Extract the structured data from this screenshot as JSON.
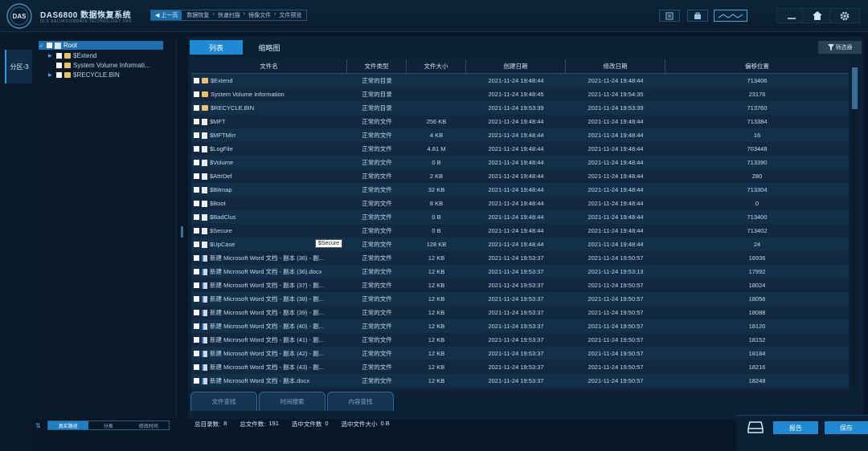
{
  "app": {
    "brand": "DAS6800 数据恢复系统",
    "brand_sub": "DLS SALVATIONDATA TECHNOLOGY DAS"
  },
  "nav": {
    "back_label": "上一页",
    "breadcrumb": [
      "数据恢复",
      "快速扫描",
      "镜像文件",
      "文件预览"
    ]
  },
  "sidebar": {
    "partition_tab": "分区-3"
  },
  "tree": {
    "items": [
      "Root",
      "$Extend",
      "System Volume Informati...",
      "$RECYCLE.BIN"
    ]
  },
  "sort_tabs": [
    "真实路径",
    "分类",
    "修改时间"
  ],
  "tabs": [
    "列表",
    "缩略图"
  ],
  "filter_label": "筛选器",
  "columns": [
    "文件名",
    "文件类型",
    "文件大小",
    "创建日期",
    "修改日期",
    "偏移位置"
  ],
  "rows": [
    [
      "$Extend",
      "正常的目录",
      "",
      "2021-11-24 19:48:44",
      "2021-11-24 19:48:44",
      "713406"
    ],
    [
      "System Volume Information",
      "正常的目录",
      "",
      "2021-11-24 19:48:45",
      "2021-11-24 19:54:35",
      "23176"
    ],
    [
      "$RECYCLE.BIN",
      "正常的目录",
      "",
      "2021-11-24 19:53:39",
      "2021-11-24 19:53:39",
      "713760"
    ],
    [
      "$MFT",
      "正常的文件",
      "256 KB",
      "2021-11-24 19:48:44",
      "2021-11-24 19:48:44",
      "713384"
    ],
    [
      "$MFTMirr",
      "正常的文件",
      "4 KB",
      "2021-11-24 19:48:44",
      "2021-11-24 19:48:44",
      "16"
    ],
    [
      "$LogFile",
      "正常的文件",
      "4.81 M",
      "2021-11-24 19:48:44",
      "2021-11-24 19:48:44",
      "703448"
    ],
    [
      "$Volume",
      "正常的文件",
      "0 B",
      "2021-11-24 19:48:44",
      "2021-11-24 19:48:44",
      "713390"
    ],
    [
      "$AttrDef",
      "正常的文件",
      "2 KB",
      "2021-11-24 19:48:44",
      "2021-11-24 19:48:44",
      "280"
    ],
    [
      "$Bitmap",
      "正常的文件",
      "32 KB",
      "2021-11-24 19:48:44",
      "2021-11-24 19:48:44",
      "713304"
    ],
    [
      "$Boot",
      "正常的文件",
      "8 KB",
      "2021-11-24 19:48:44",
      "2021-11-24 19:48:44",
      "0"
    ],
    [
      "$BadClus",
      "正常的文件",
      "0 B",
      "2021-11-24 19:48:44",
      "2021-11-24 19:48:44",
      "713400"
    ],
    [
      "$Secure",
      "正常的文件",
      "0 B",
      "2021-11-24 19:48:44",
      "2021-11-24 19:48:44",
      "713402"
    ],
    [
      "$UpCase",
      "正常的文件",
      "128 KB",
      "2021-11-24 19:48:44",
      "2021-11-24 19:48:44",
      "24"
    ],
    [
      "新建 Microsoft Word 文档 - 副本 (36) - 副...",
      "正常的文件",
      "12 KB",
      "2021-11-24 19:53:37",
      "2021-11-24 19:50:57",
      "16936"
    ],
    [
      "新建 Microsoft Word 文档 - 副本 (36).docx",
      "正常的文件",
      "12 KB",
      "2021-11-24 19:53:37",
      "2021-11-24 19:53:13",
      "17992"
    ],
    [
      "新建 Microsoft Word 文档 - 副本 (37) - 副...",
      "正常的文件",
      "12 KB",
      "2021-11-24 19:53:37",
      "2021-11-24 19:50:57",
      "18024"
    ],
    [
      "新建 Microsoft Word 文档 - 副本 (38) - 副...",
      "正常的文件",
      "12 KB",
      "2021-11-24 19:53:37",
      "2021-11-24 19:50:57",
      "18056"
    ],
    [
      "新建 Microsoft Word 文档 - 副本 (39) - 副...",
      "正常的文件",
      "12 KB",
      "2021-11-24 19:53:37",
      "2021-11-24 19:50:57",
      "18088"
    ],
    [
      "新建 Microsoft Word 文档 - 副本 (40) - 副...",
      "正常的文件",
      "12 KB",
      "2021-11-24 19:53:37",
      "2021-11-24 19:50:57",
      "18120"
    ],
    [
      "新建 Microsoft Word 文档 - 副本 (41) - 副...",
      "正常的文件",
      "12 KB",
      "2021-11-24 19:53:37",
      "2021-11-24 19:50:57",
      "18152"
    ],
    [
      "新建 Microsoft Word 文档 - 副本 (42) - 副...",
      "正常的文件",
      "12 KB",
      "2021-11-24 19:53:37",
      "2021-11-24 19:50:57",
      "18184"
    ],
    [
      "新建 Microsoft Word 文档 - 副本 (43) - 副...",
      "正常的文件",
      "12 KB",
      "2021-11-24 19:53:37",
      "2021-11-24 19:50:57",
      "18216"
    ],
    [
      "新建 Microsoft Word 文档 - 副本.docx",
      "正常的文件",
      "12 KB",
      "2021-11-24 19:53:37",
      "2021-11-24 19:50:57",
      "18248"
    ]
  ],
  "tooltip": "$Secure",
  "bottom_tabs": [
    "文件查找",
    "时间搜索",
    "内容查找"
  ],
  "status": {
    "dirs_label": "总目录数:",
    "dirs_value": "8",
    "files_label": "总文件数:",
    "files_value": "191",
    "sel_files_label": "选中文件数",
    "sel_files_value": "0",
    "sel_size_label": "选中文件大小",
    "sel_size_value": "0 B"
  },
  "buttons": {
    "report": "报告",
    "save": "保存"
  },
  "colors": {
    "accent": "#1e8ad4",
    "folder": "#e9c36a",
    "background": "#081726"
  }
}
